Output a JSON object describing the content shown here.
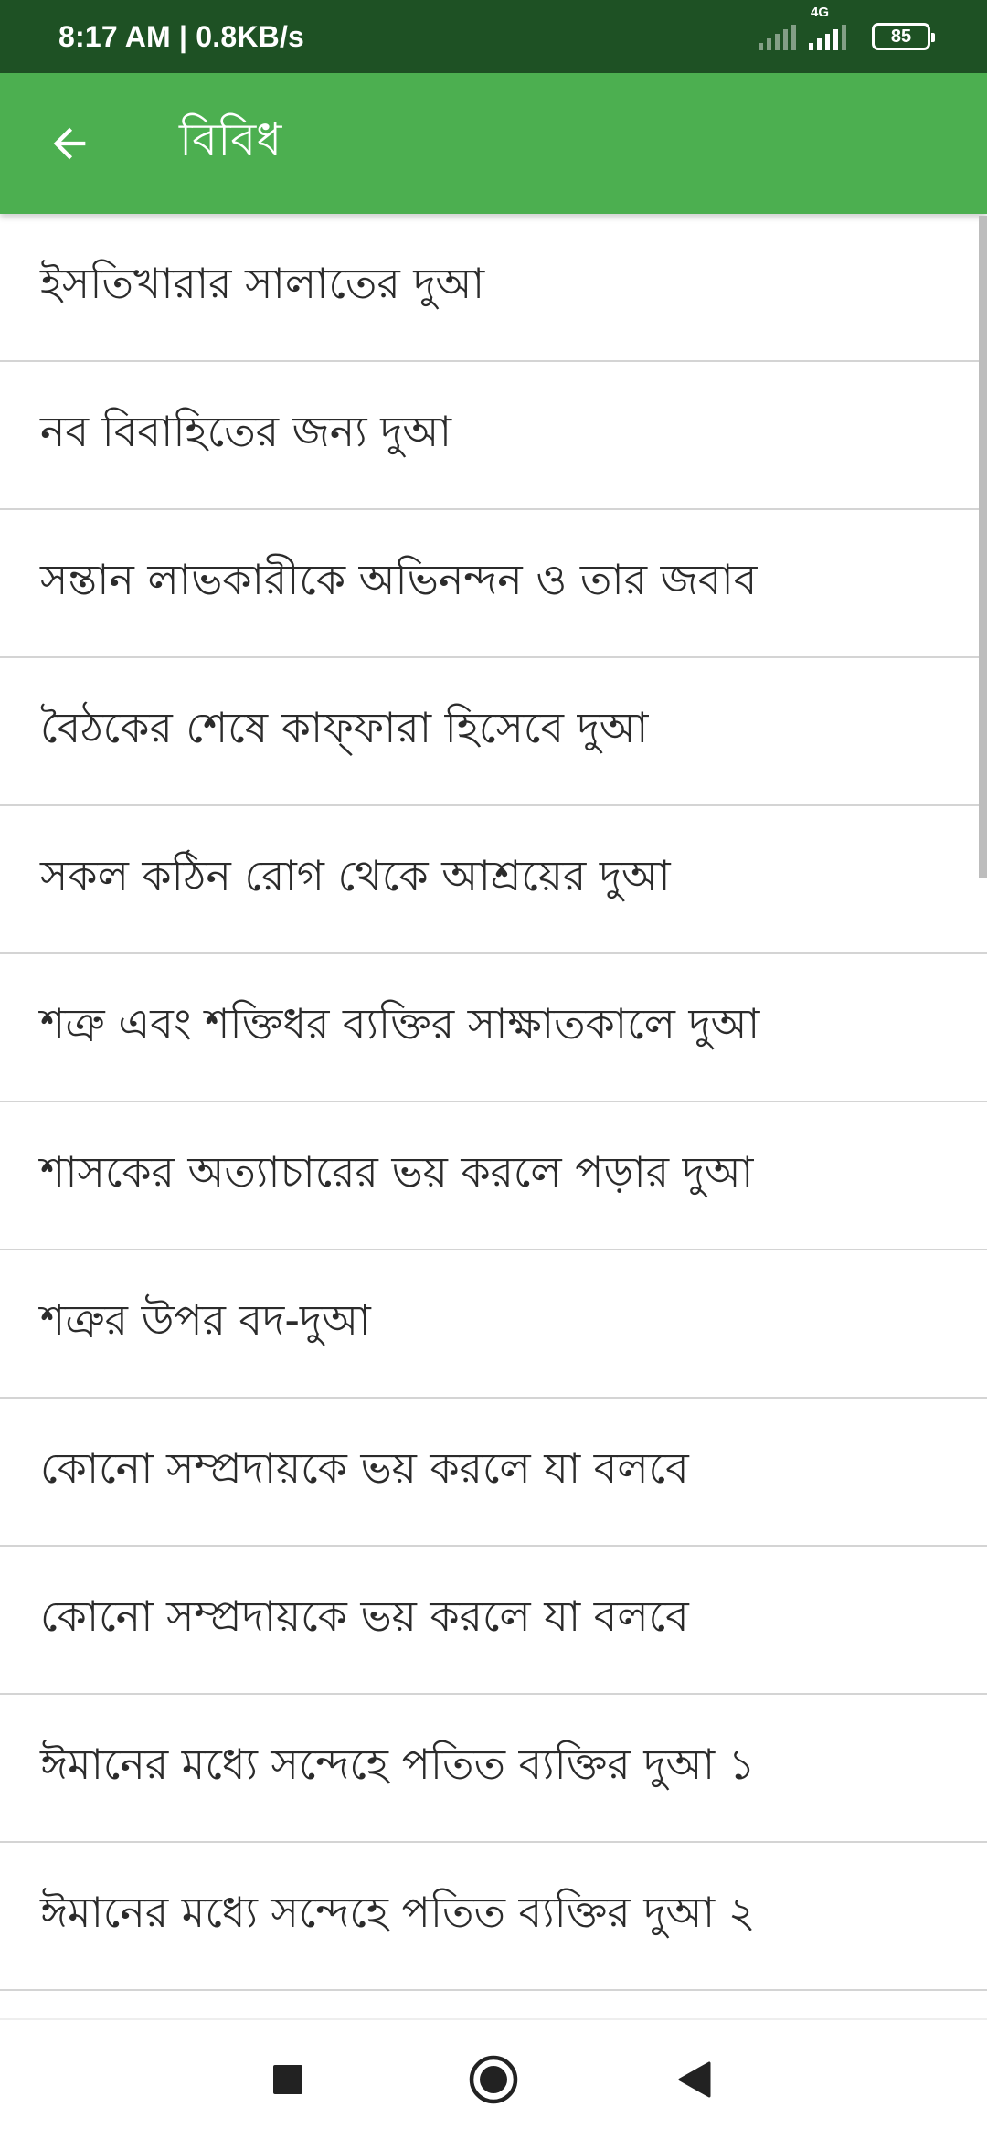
{
  "status_bar": {
    "time_speed": "8:17 AM | 0.8KB/s",
    "network_type": "4G",
    "battery": "85"
  },
  "app_bar": {
    "title": "বিবিধ",
    "back_icon": "arrow-left-icon"
  },
  "list": {
    "items": [
      {
        "label": "ইসতিখারার সালাতের দুআ"
      },
      {
        "label": "নব বিবাহিতের জন্য দুআ"
      },
      {
        "label": "সন্তান লাভকারীকে অভিনন্দন ও তার জবাব"
      },
      {
        "label": "বৈঠকের শেষে কাফ্‌ফারা হিসেবে দুআ"
      },
      {
        "label": "সকল কঠিন রোগ থেকে আশ্রয়ের দুআ"
      },
      {
        "label": "শত্রু এবং শক্তিধর ব্যক্তির সাক্ষাতকালে দুআ"
      },
      {
        "label": "শাসকের অত্যাচারের ভয় করলে পড়ার দুআ"
      },
      {
        "label": "শত্রুর উপর বদ-দুআ"
      },
      {
        "label": "কোনো সম্প্রদায়কে ভয় করলে যা বলবে"
      },
      {
        "label": "কোনো সম্প্রদায়কে ভয় করলে যা বলবে"
      },
      {
        "label": "ঈমানের মধ্যে সন্দেহে পতিত ব্যক্তির দুআ ১"
      },
      {
        "label": "ঈমানের মধ্যে সন্দেহে পতিত ব্যক্তির দুআ ২"
      }
    ]
  },
  "nav_bar": {
    "recents_icon": "square-icon",
    "home_icon": "circle-icon",
    "back_icon": "triangle-back-icon"
  },
  "colors": {
    "status_bar": "#1e5124",
    "app_bar": "#4caf50",
    "divider": "#d4d4d4",
    "text": "#2b2b2b"
  }
}
